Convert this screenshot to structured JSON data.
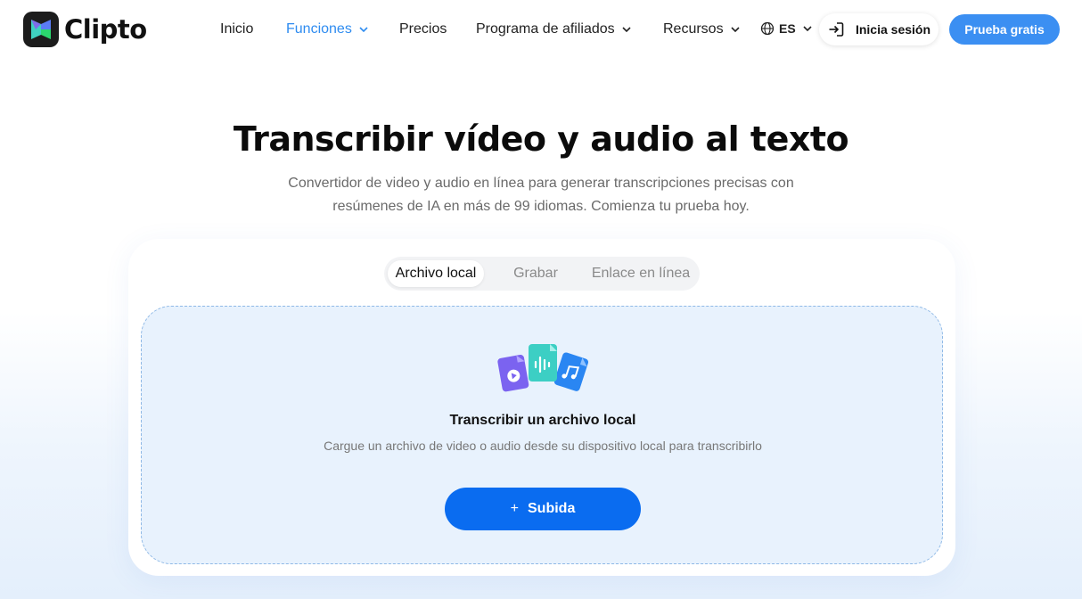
{
  "brand": {
    "name": "Clipto"
  },
  "nav": {
    "items": [
      {
        "label": "Inicio",
        "dropdown": false,
        "active": false
      },
      {
        "label": "Funciones",
        "dropdown": true,
        "active": true
      },
      {
        "label": "Precios",
        "dropdown": false,
        "active": false
      },
      {
        "label": "Programa de afiliados",
        "dropdown": true,
        "active": false
      },
      {
        "label": "Recursos",
        "dropdown": true,
        "active": false
      }
    ],
    "language": "ES",
    "login_label": "Inicia sesión",
    "trial_label": "Prueba gratis"
  },
  "hero": {
    "title": "Transcribir vídeo y audio al texto",
    "subtitle_line1": "Convertidor de video y audio en línea para generar transcripciones precisas con",
    "subtitle_line2": "resúmenes de IA en más de 99 idiomas. Comienza tu prueba hoy."
  },
  "uploader": {
    "tabs": [
      {
        "label": "Archivo local",
        "active": true
      },
      {
        "label": "Grabar",
        "active": false
      },
      {
        "label": "Enlace en línea",
        "active": false
      }
    ],
    "title": "Transcribir un archivo local",
    "description": "Cargue un archivo de video o audio desde su dispositivo local para transcribirlo",
    "button_label": "Subida"
  },
  "colors": {
    "accent": "#2f8cf0",
    "trial_button": "#3b8ff2",
    "upload_button": "#0a6cf0",
    "dropzone_bg": "#e8f2fd"
  },
  "icons": [
    "logo-mark",
    "chevron-down-icon",
    "globe-icon",
    "login-icon",
    "video-file-icon",
    "audio-file-icon",
    "music-file-icon",
    "plus-icon"
  ]
}
